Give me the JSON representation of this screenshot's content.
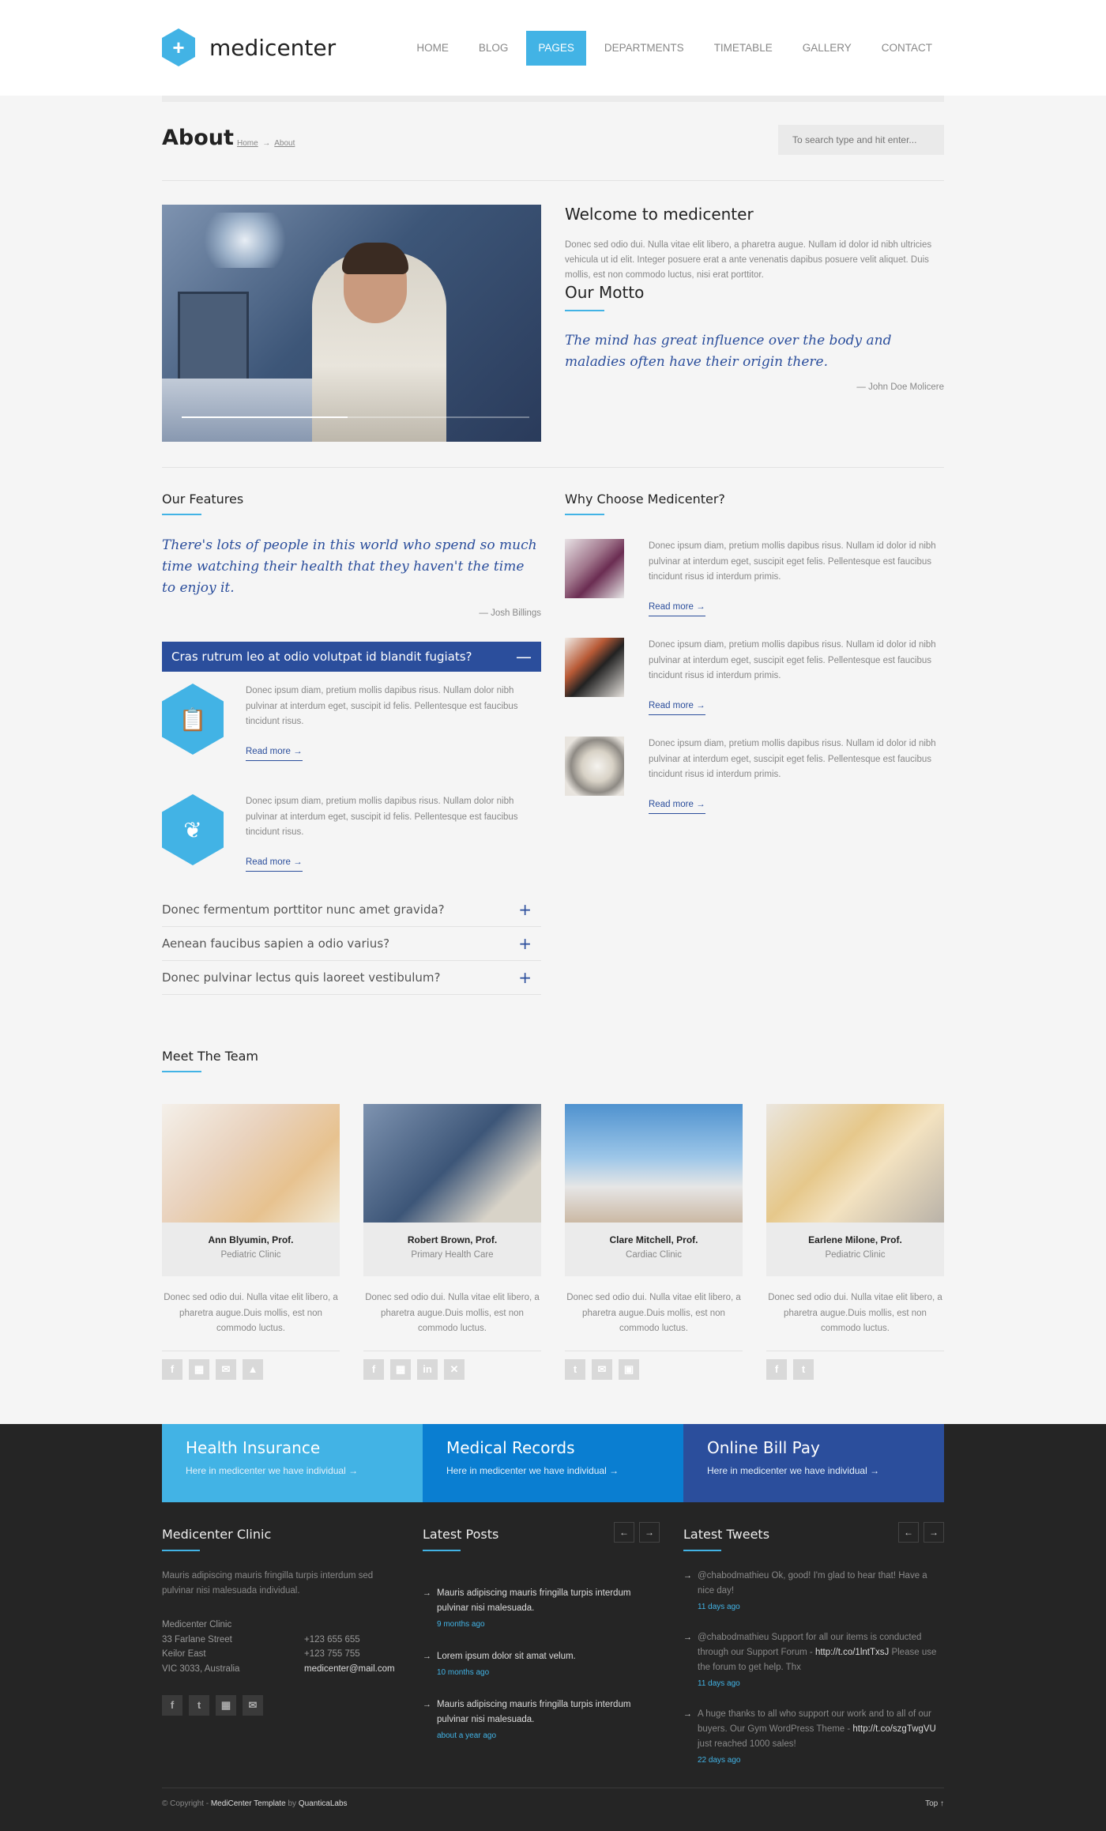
{
  "header": {
    "logo_text": "medicenter",
    "menu": [
      {
        "label": "HOME"
      },
      {
        "label": "BLOG"
      },
      {
        "label": "PAGES"
      },
      {
        "label": "DEPARTMENTS"
      },
      {
        "label": "TIMETABLE"
      },
      {
        "label": "GALLERY"
      },
      {
        "label": "CONTACT"
      }
    ],
    "active_menu": "PAGES"
  },
  "page_header": {
    "title": "About",
    "breadcrumb": {
      "home": "Home",
      "sep": "→",
      "current": "About"
    },
    "search_placeholder": "To search type and hit enter..."
  },
  "about": {
    "welcome_title": "Welcome to medicenter",
    "welcome_text": "Donec sed odio dui. Nulla vitae elit libero, a pharetra augue. Nullam id dolor id nibh ultricies vehicula ut id elit. Integer posuere erat a ante venenatis dapibus posuere velit aliquet. Duis mollis, est non commodo luctus, nisi erat porttitor.",
    "motto_title": "Our Motto",
    "motto_quote": "The mind has great influence over the body and maladies often have their origin there.",
    "motto_author": "— John Doe Molicere"
  },
  "features": {
    "title": "Our Features",
    "quote": "There's lots of people in this world who spend so much time watching their health that they haven't the time to enjoy it.",
    "quote_author": "— Josh Billings",
    "open_item": {
      "label": "Cras rutrum leo at odio volutpat id blandit fugiats?",
      "sign": "—"
    },
    "items": [
      {
        "text": "Donec ipsum diam, pretium mollis dapibus risus. Nullam dolor nibh pulvinar at interdum eget, suscipit id felis. Pellentesque est faucibus tincidunt risus.",
        "link": "Read more →"
      },
      {
        "text": "Donec ipsum diam, pretium mollis dapibus risus. Nullam dolor nibh pulvinar at interdum eget, suscipit id felis. Pellentesque est faucibus tincidunt risus.",
        "link": "Read more →"
      }
    ],
    "collapsed": [
      {
        "label": "Donec fermentum porttitor nunc amet gravida?",
        "sign": "+"
      },
      {
        "label": "Aenean faucibus sapien a odio varius?",
        "sign": "+"
      },
      {
        "label": "Donec pulvinar lectus quis laoreet vestibulum?",
        "sign": "+"
      }
    ]
  },
  "why": {
    "title": "Why Choose Medicenter?",
    "items": [
      {
        "text": "Donec ipsum diam, pretium mollis dapibus risus. Nullam id dolor id nibh pulvinar at interdum eget, suscipit eget felis. Pellentesque est faucibus tincidunt risus id interdum primis.",
        "link": "Read more →"
      },
      {
        "text": "Donec ipsum diam, pretium mollis dapibus risus. Nullam id dolor id nibh pulvinar at interdum eget, suscipit eget felis. Pellentesque est faucibus tincidunt risus id interdum primis.",
        "link": "Read more →"
      },
      {
        "text": "Donec ipsum diam, pretium mollis dapibus risus. Nullam id dolor id nibh pulvinar at interdum eget, suscipit eget felis. Pellentesque est faucibus tincidunt risus id interdum primis.",
        "link": "Read more →"
      }
    ]
  },
  "team": {
    "title": "Meet The Team",
    "members": [
      {
        "name": "Ann Blyumin, Prof.",
        "role": "Pediatric Clinic",
        "text": "Donec sed odio dui. Nulla vitae elit libero, a pharetra augue.Duis mollis, est non commodo luctus.",
        "social": [
          "f",
          "▦",
          "✉",
          "▲"
        ]
      },
      {
        "name": "Robert Brown, Prof.",
        "role": "Primary Health Care",
        "text": "Donec sed odio dui. Nulla vitae elit libero, a pharetra augue.Duis mollis, est non commodo luctus.",
        "social": [
          "f",
          "▦",
          "in",
          "✕"
        ]
      },
      {
        "name": "Clare Mitchell, Prof.",
        "role": "Cardiac Clinic",
        "text": "Donec sed odio dui. Nulla vitae elit libero, a pharetra augue.Duis mollis, est non commodo luctus.",
        "social": [
          "t",
          "✉",
          "▣"
        ]
      },
      {
        "name": "Earlene Milone, Prof.",
        "role": "Pediatric Clinic",
        "text": "Donec sed odio dui. Nulla vitae elit libero, a pharetra augue.Duis mollis, est non commodo luctus.",
        "social": [
          "f",
          "t"
        ]
      }
    ]
  },
  "footer": {
    "boxes": [
      {
        "title": "Health Insurance",
        "text": "Here in medicenter we have individual →",
        "color": "#42b3e5"
      },
      {
        "title": "Medical Records",
        "text": "Here in medicenter we have individual →",
        "color": "#0a7ed1"
      },
      {
        "title": "Online Bill Pay",
        "text": "Here in medicenter we have individual →",
        "color": "#2b4e9c"
      }
    ],
    "clinic": {
      "title": "Medicenter Clinic",
      "text": "Mauris adipiscing mauris fringilla turpis interdum sed pulvinar nisi malesuada individual.",
      "addr_lines": [
        "Medicenter Clinic",
        "33 Farlane Street",
        "Keilor East",
        "VIC 3033, Australia"
      ],
      "phone1": "+123 655 655",
      "phone2": "+123 755 755",
      "email": "medicenter@mail.com",
      "social": [
        "f",
        "t",
        "▦",
        "✉"
      ]
    },
    "posts": {
      "title": "Latest Posts",
      "prev": "←",
      "next": "→",
      "items": [
        {
          "text": "Mauris adipiscing mauris fringilla turpis interdum pulvinar nisi malesuada.",
          "date": "9 months ago"
        },
        {
          "text": "Lorem ipsum dolor sit amat velum.",
          "date": "10 months ago"
        },
        {
          "text": "Mauris adipiscing mauris fringilla turpis interdum pulvinar nisi malesuada.",
          "date": "about a year ago"
        }
      ]
    },
    "tweets": {
      "title": "Latest Tweets",
      "prev": "←",
      "next": "→",
      "items": [
        {
          "pre": "@chabodmathieu Ok, good! I'm glad to hear that! Have a nice day!",
          "link": "",
          "post": "",
          "date": "11 days ago"
        },
        {
          "pre": "@chabodmathieu Support for all our items is conducted through our Support Forum - ",
          "link": "http://t.co/1lntTxsJ",
          "post": " Please use the forum to get help. Thx",
          "date": "11 days ago"
        },
        {
          "pre": "A huge thanks to all who support our work and to all of our buyers. Our Gym WordPress Theme - ",
          "link": "http://t.co/szgTwgVU",
          "post": " just reached 1000 sales!",
          "date": "22 days ago"
        }
      ]
    },
    "copyright_pre": "© Copyright - ",
    "copyright_name": "MediCenter Template",
    "copyright_by": " by ",
    "copyright_company": "QuanticaLabs",
    "top_label": "Top ↑"
  }
}
